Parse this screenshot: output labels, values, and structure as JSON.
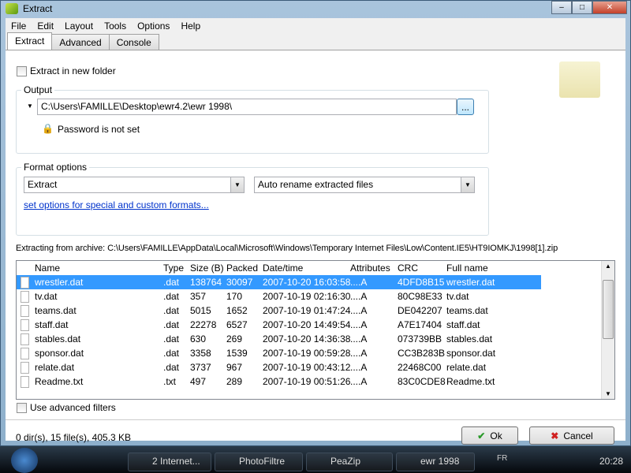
{
  "window": {
    "title": "Extract"
  },
  "menu": [
    "File",
    "Edit",
    "Layout",
    "Tools",
    "Options",
    "Help"
  ],
  "tabs": [
    "Extract",
    "Advanced",
    "Console"
  ],
  "extract_new_folder": "Extract in new folder",
  "output": {
    "legend": "Output",
    "path": "C:\\Users\\FAMILLE\\Desktop\\ewr4.2\\ewr 1998\\",
    "browse": "...",
    "password": "Password is not set"
  },
  "format": {
    "legend": "Format options",
    "mode": "Extract",
    "rename": "Auto rename extracted files",
    "link": "set options for special and custom formats..."
  },
  "archive_label": "Extracting from archive: C:\\Users\\FAMILLE\\AppData\\Local\\Microsoft\\Windows\\Temporary Internet Files\\Low\\Content.IE5\\HT9IOMKJ\\1998[1].zip",
  "columns": [
    "Name",
    "Type",
    "Size (B)",
    "Packed",
    "Date/time",
    "Attributes",
    "CRC",
    "Full name"
  ],
  "files": [
    [
      "wrestler.dat",
      ".dat",
      "138764",
      "30097",
      "2007-10-20 16:03:58",
      "....A",
      "4DFD8B15",
      "wrestler.dat"
    ],
    [
      "tv.dat",
      ".dat",
      "357",
      "170",
      "2007-10-19 02:16:30",
      "....A",
      "80C98E33",
      "tv.dat"
    ],
    [
      "teams.dat",
      ".dat",
      "5015",
      "1652",
      "2007-10-19 01:47:24",
      "....A",
      "DE042207",
      "teams.dat"
    ],
    [
      "staff.dat",
      ".dat",
      "22278",
      "6527",
      "2007-10-20 14:49:54",
      "....A",
      "A7E17404",
      "staff.dat"
    ],
    [
      "stables.dat",
      ".dat",
      "630",
      "269",
      "2007-10-20 14:36:38",
      "....A",
      "073739BB",
      "stables.dat"
    ],
    [
      "sponsor.dat",
      ".dat",
      "3358",
      "1539",
      "2007-10-19 00:59:28",
      "....A",
      "CC3B283B",
      "sponsor.dat"
    ],
    [
      "relate.dat",
      ".dat",
      "3737",
      "967",
      "2007-10-19 00:43:12",
      "....A",
      "22468C00",
      "relate.dat"
    ],
    [
      "Readme.txt",
      ".txt",
      "497",
      "289",
      "2007-10-19 00:51:26",
      "....A",
      "83C0CDE8",
      "Readme.txt"
    ]
  ],
  "advanced_filters": "Use advanced filters",
  "status": "0 dir(s), 15 file(s), 405.3 KB",
  "ok": "Ok",
  "cancel": "Cancel",
  "taskbar": {
    "items": [
      "2 Internet...",
      "PhotoFiltre",
      "PeaZip",
      "ewr 1998"
    ],
    "lang": "FR",
    "clock": "20:28"
  }
}
